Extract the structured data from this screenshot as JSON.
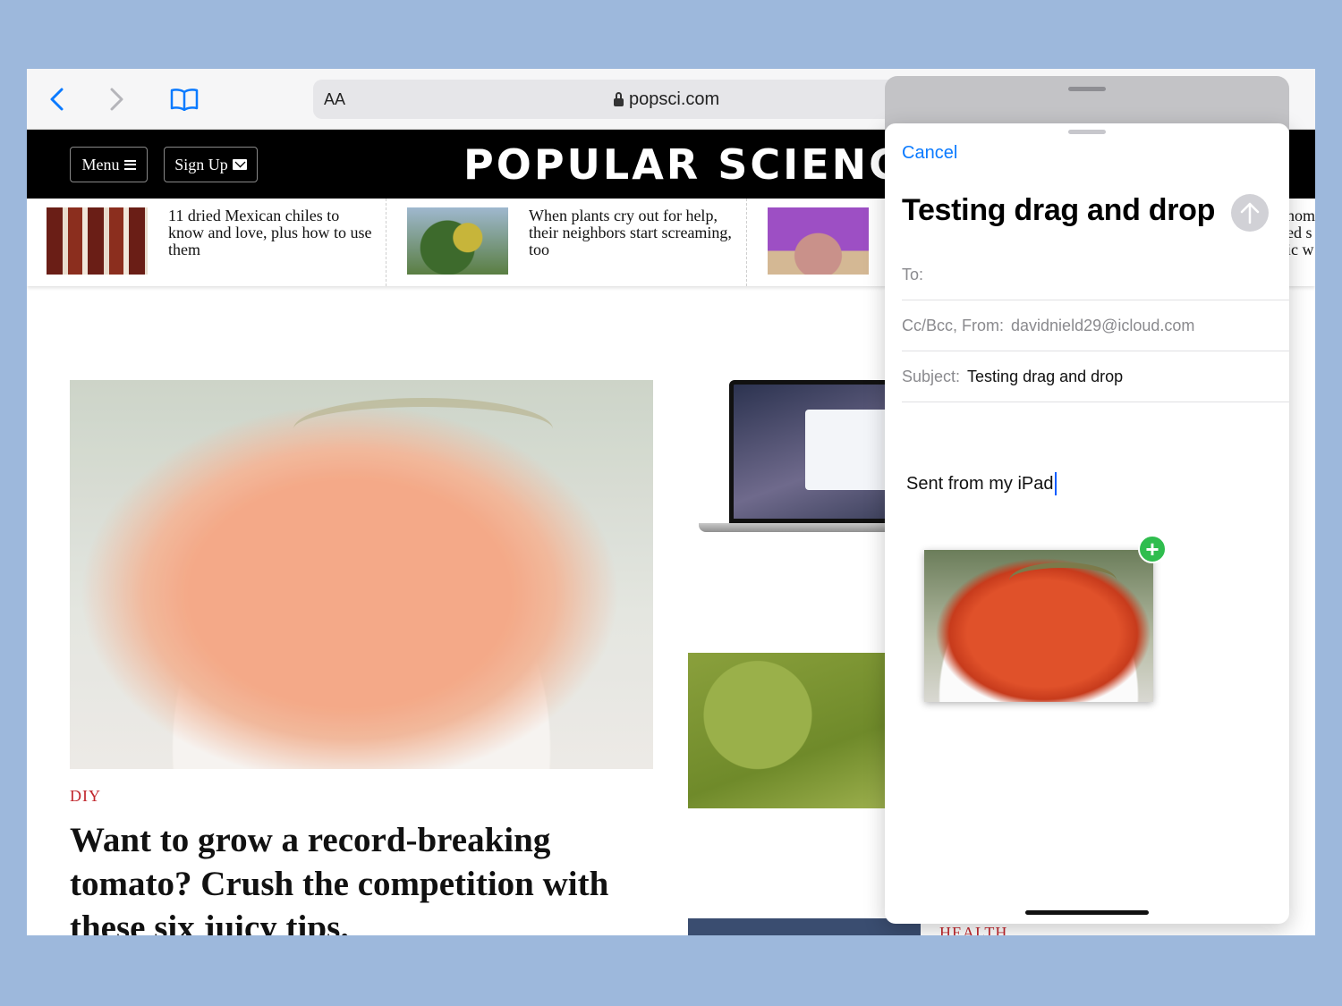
{
  "browser": {
    "text_size_label": "AA",
    "url": "popsci.com"
  },
  "site": {
    "menu_label": "Menu",
    "signup_label": "Sign Up",
    "logo": "POPULAR SCIENCE"
  },
  "trending": [
    {
      "text": "11 dried Mexican chiles to know and love, plus how to use them"
    },
    {
      "text": "When plants cry out for help, their neighbors start screaming, too"
    }
  ],
  "article": {
    "category": "DIY",
    "headline": "Want to grow a record-breaking tomato? Crush the competition with these six juicy tips."
  },
  "secondary": {
    "category": "HEALTH",
    "partial_text": "nom\ned s\nic w"
  },
  "mail": {
    "cancel_label": "Cancel",
    "title": "Testing drag and drop",
    "to_label": "To:",
    "to_value": "",
    "cc_label": "Cc/Bcc, From:",
    "from_value": "davidnield29@icloud.com",
    "subject_label": "Subject:",
    "subject_value": "Testing drag and drop",
    "body": "Sent from my iPad",
    "accent_color": "#0a7aff",
    "add_badge_color": "#2fbd4e"
  }
}
